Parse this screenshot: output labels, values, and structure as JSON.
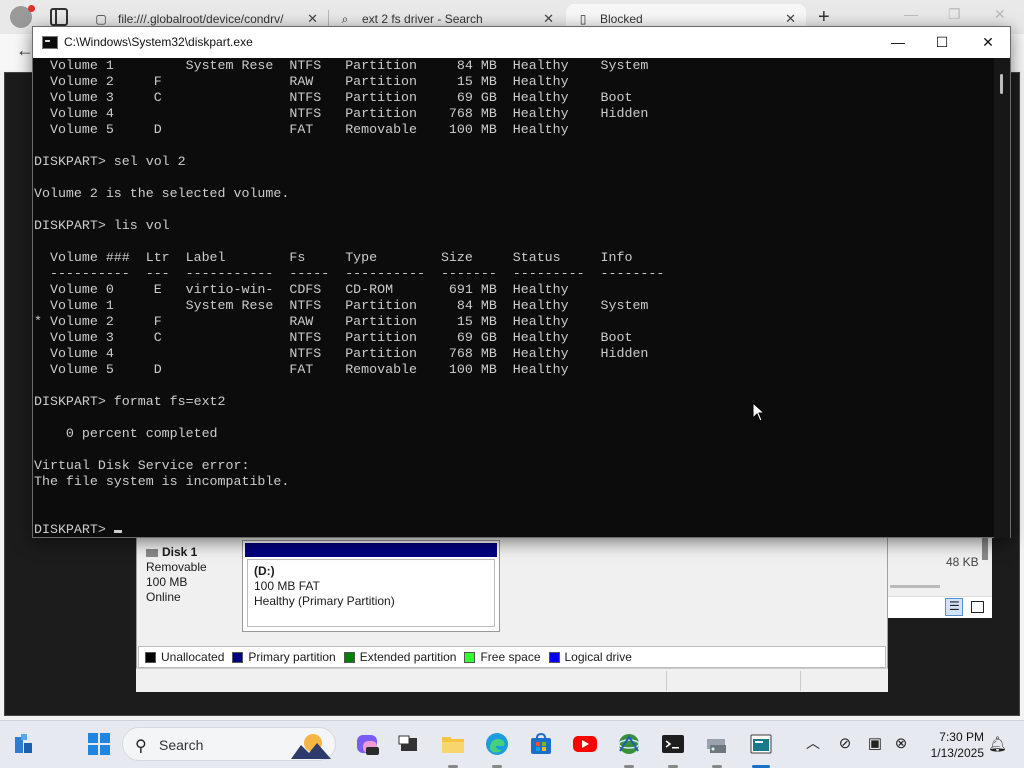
{
  "browser": {
    "tabs": [
      {
        "title": "file:///.globalroot/device/condrv/",
        "icon": "page-icon"
      },
      {
        "title": "ext 2 fs driver - Search",
        "icon": "search-icon"
      },
      {
        "title": "Blocked",
        "icon": "document-icon"
      }
    ],
    "new_tab_label": "+"
  },
  "console": {
    "title": "C:\\Windows\\System32\\diskpart.exe",
    "lines": [
      "  Volume 1         System Rese  NTFS   Partition     84 MB  Healthy    System",
      "  Volume 2     F                RAW    Partition     15 MB  Healthy",
      "  Volume 3     C                NTFS   Partition     69 GB  Healthy    Boot",
      "  Volume 4                      NTFS   Partition    768 MB  Healthy    Hidden",
      "  Volume 5     D                FAT    Removable    100 MB  Healthy",
      "",
      "DISKPART> sel vol 2",
      "",
      "Volume 2 is the selected volume.",
      "",
      "DISKPART> lis vol",
      "",
      "  Volume ###  Ltr  Label        Fs     Type        Size     Status     Info",
      "  ----------  ---  -----------  -----  ----------  -------  ---------  --------",
      "  Volume 0     E   virtio-win-  CDFS   CD-ROM       691 MB  Healthy",
      "  Volume 1         System Rese  NTFS   Partition     84 MB  Healthy    System",
      "* Volume 2     F                RAW    Partition     15 MB  Healthy",
      "  Volume 3     C                NTFS   Partition     69 GB  Healthy    Boot",
      "  Volume 4                      NTFS   Partition    768 MB  Healthy    Hidden",
      "  Volume 5     D                FAT    Removable    100 MB  Healthy",
      "",
      "DISKPART> format fs=ext2",
      "",
      "    0 percent completed",
      "",
      "Virtual Disk Service error:",
      "The file system is incompatible.",
      "",
      ""
    ],
    "prompt": "DISKPART> "
  },
  "disk_management": {
    "disk_name": "Disk 1",
    "disk_type": "Removable",
    "disk_size": "100 MB",
    "disk_status": "Online",
    "partition_name": "(D:)",
    "partition_info": "100 MB FAT",
    "partition_status": "Healthy (Primary Partition)",
    "size_column_value": "48 KB",
    "legend": [
      {
        "label": "Unallocated",
        "color": "#000000"
      },
      {
        "label": "Primary partition",
        "color": "#00007e"
      },
      {
        "label": "Extended partition",
        "color": "#008000"
      },
      {
        "label": "Free space",
        "color": "#33ff33"
      },
      {
        "label": "Logical drive",
        "color": "#0000ff"
      }
    ]
  },
  "taskbar": {
    "search_placeholder": "Search",
    "time": "7:30 PM",
    "date": "1/13/2025"
  }
}
